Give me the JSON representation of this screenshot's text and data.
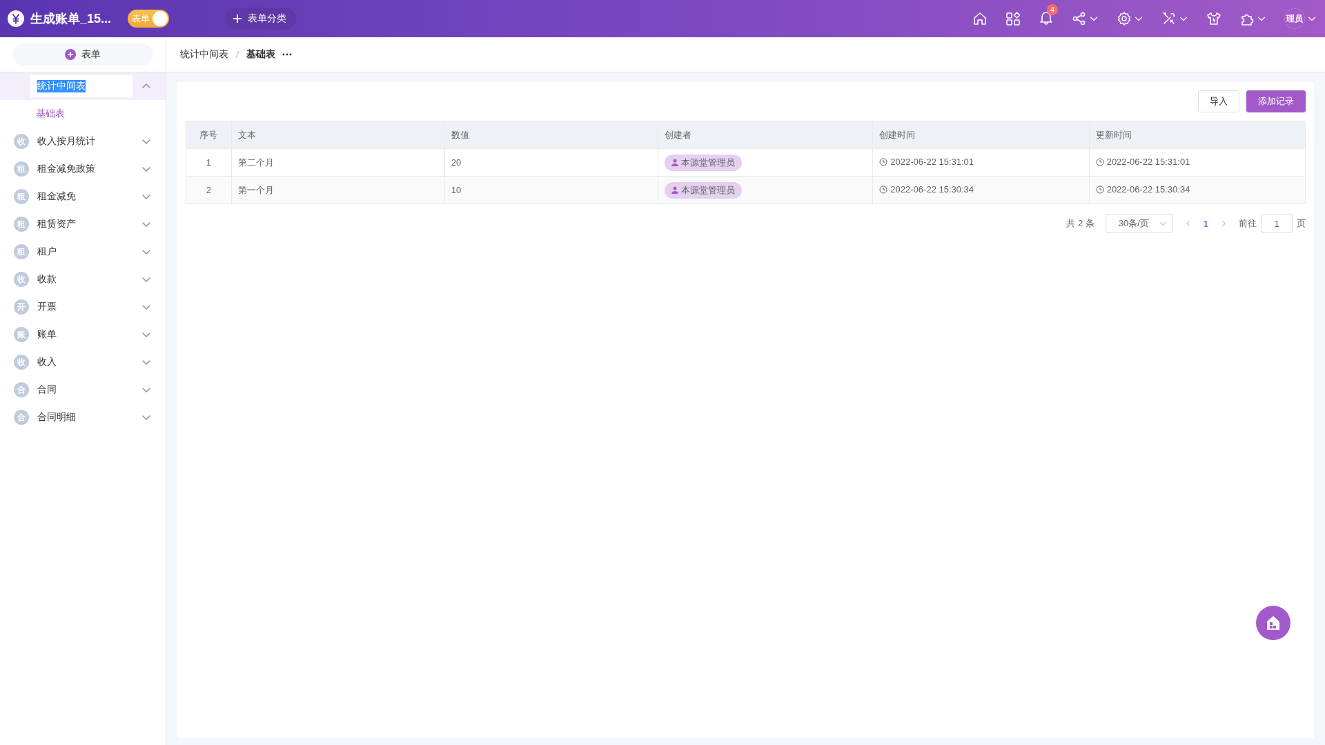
{
  "header": {
    "app_title": "生成账单_15...",
    "mode_toggle": {
      "label": "表单",
      "on": true
    },
    "category_button": "表单分类",
    "notification_count": "4",
    "user_avatar": "理员"
  },
  "sidebar": {
    "new_button": "表单",
    "items": [
      {
        "label": "统计中间表",
        "expanded": true,
        "editing": true,
        "children": [
          {
            "label": "基础表",
            "selected": true
          }
        ]
      },
      {
        "badge": "收",
        "label": "收入按月统计",
        "expanded": false
      },
      {
        "badge": "租",
        "label": "租金减免政策",
        "expanded": false
      },
      {
        "badge": "租",
        "label": "租金减免",
        "expanded": false
      },
      {
        "badge": "租",
        "label": "租赁资产",
        "expanded": false
      },
      {
        "badge": "租",
        "label": "租户",
        "expanded": false
      },
      {
        "badge": "收",
        "label": "收款",
        "expanded": false
      },
      {
        "badge": "开",
        "label": "开票",
        "expanded": false
      },
      {
        "badge": "账",
        "label": "账单",
        "expanded": false
      },
      {
        "badge": "收",
        "label": "收入",
        "expanded": false
      },
      {
        "badge": "合",
        "label": "合同",
        "expanded": false
      },
      {
        "badge": "合",
        "label": "合同明细",
        "expanded": false
      }
    ]
  },
  "breadcrumb": [
    "统计中间表",
    "基础表"
  ],
  "toolbar": {
    "import_button": "导入",
    "add_button": "添加记录"
  },
  "table": {
    "columns": [
      "序号",
      "文本",
      "数值",
      "创建者",
      "创建时间",
      "更新时间"
    ],
    "rows": [
      {
        "index": "1",
        "text": "第二个月",
        "value": "20",
        "creator": "本源堂管理员",
        "created": "2022-06-22 15:31:01",
        "updated": "2022-06-22 15:31:01"
      },
      {
        "index": "2",
        "text": "第一个月",
        "value": "10",
        "creator": "本源堂管理员",
        "created": "2022-06-22 15:30:34",
        "updated": "2022-06-22 15:30:34"
      }
    ]
  },
  "pagination": {
    "total": "共 2 条",
    "page_size": "30条/页",
    "pages": [
      {
        "label": "1",
        "selected": true
      }
    ],
    "goto_label": "前往",
    "goto_value": "1",
    "goto_suffix": "页"
  }
}
